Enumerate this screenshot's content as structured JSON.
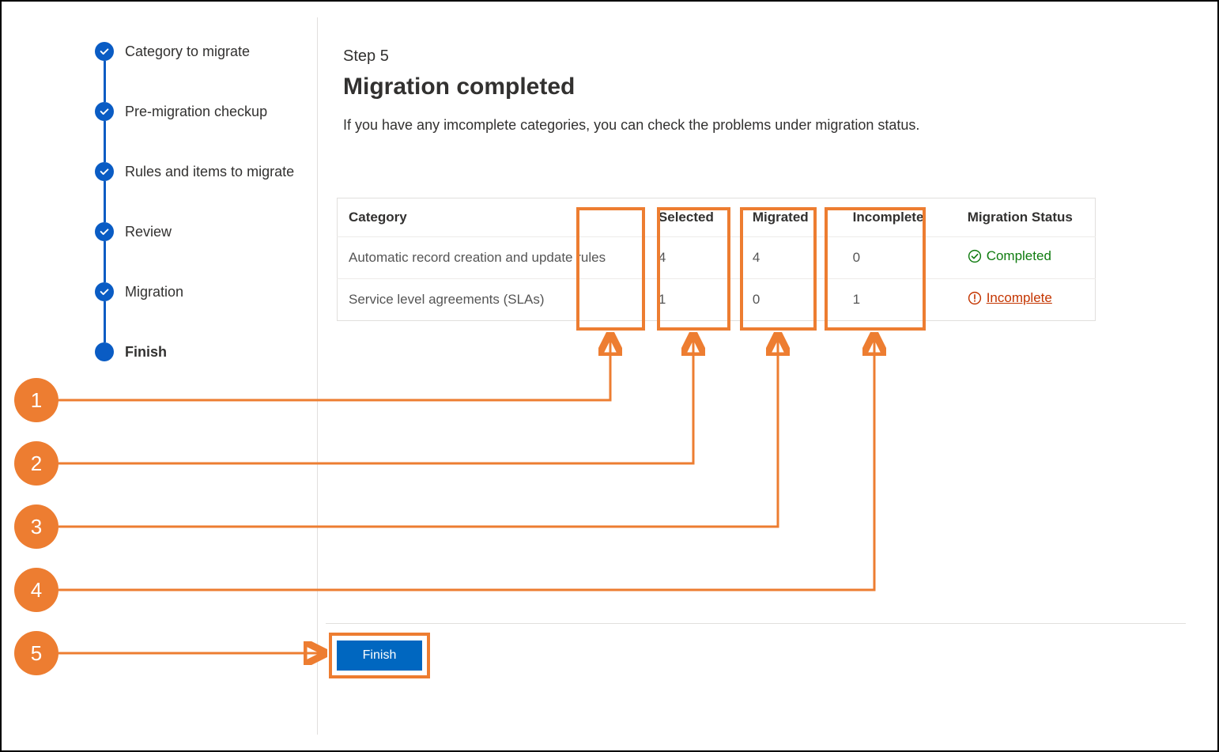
{
  "stepper": {
    "items": [
      {
        "label": "Category to migrate",
        "state": "done"
      },
      {
        "label": "Pre-migration checkup",
        "state": "done"
      },
      {
        "label": "Rules and items to migrate",
        "state": "done"
      },
      {
        "label": "Review",
        "state": "done"
      },
      {
        "label": "Migration",
        "state": "done"
      },
      {
        "label": "Finish",
        "state": "current"
      }
    ]
  },
  "main": {
    "kicker": "Step 5",
    "title": "Migration completed",
    "description": "If you have any imcomplete categories, you can check the problems under migration status."
  },
  "table": {
    "headers": {
      "category": "Category",
      "selected": "Selected",
      "migrated": "Migrated",
      "incomplete": "Incomplete",
      "status": "Migration Status"
    },
    "rows": [
      {
        "category": "Automatic record creation and update rules",
        "selected": "4",
        "migrated": "4",
        "incomplete": "0",
        "status_label": "Completed",
        "status_kind": "ok"
      },
      {
        "category": "Service level agreements (SLAs)",
        "selected": "1",
        "migrated": "0",
        "incomplete": "1",
        "status_label": "Incomplete",
        "status_kind": "warn"
      }
    ]
  },
  "footer": {
    "finish_label": "Finish"
  },
  "annotations": {
    "callouts": [
      "1",
      "2",
      "3",
      "4",
      "5"
    ]
  }
}
